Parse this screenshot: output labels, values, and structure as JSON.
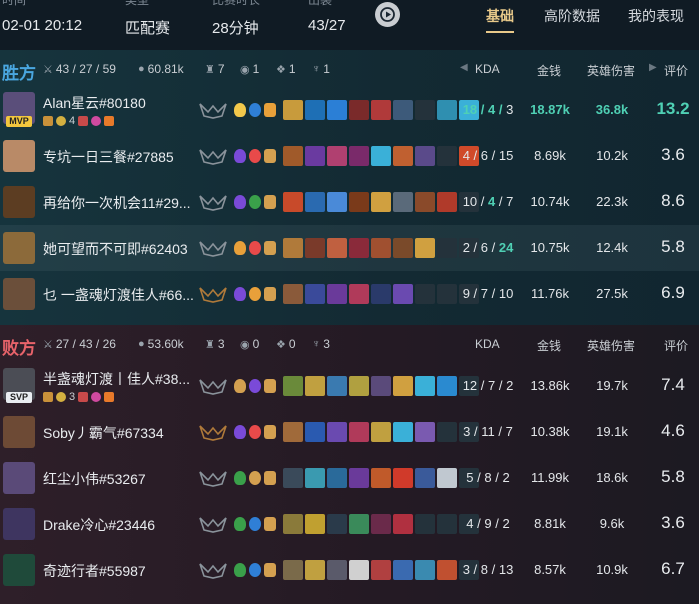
{
  "header": {
    "cols": [
      {
        "label": "时间",
        "value": "02-01 20:12"
      },
      {
        "label": "类型",
        "value": "匹配赛"
      },
      {
        "label": "比赛时长",
        "value": "28分钟"
      },
      {
        "label": "出装",
        "value": "43/27"
      }
    ],
    "tabs": [
      "基础",
      "高阶数据",
      "我的表现"
    ],
    "active_tab": "基础"
  },
  "columns": {
    "kda": "KDA",
    "gold": "金钱",
    "damage": "英雄伤害",
    "score": "评价"
  },
  "teams": [
    {
      "title": "胜方",
      "stats": {
        "kda": "43 / 27 / 59",
        "gold": "60.81k",
        "towers": "7",
        "dragons": "1",
        "heralds": "1",
        "barons": "1"
      },
      "players": [
        {
          "name": "Alan星云#80180",
          "badge": "MVP",
          "level_text": "4",
          "kda_k": "18",
          "kda_d": "4",
          "kda_a": "3",
          "gold": "18.87k",
          "damage": "36.8k",
          "score": "13.2",
          "colors": {
            "avatar": "#5a4e7a"
          }
        },
        {
          "name": "专坑一日三餐#27885",
          "kda_k": "4",
          "kda_d": "6",
          "kda_a": "15",
          "gold": "8.69k",
          "damage": "10.2k",
          "score": "3.6",
          "colors": {
            "avatar": "#b98a67"
          }
        },
        {
          "name": "再给你一次机会11#29...",
          "kda_k": "10",
          "kda_d": "4",
          "kda_a": "7",
          "gold": "10.74k",
          "damage": "22.3k",
          "score": "8.6",
          "colors": {
            "avatar": "#5c3d22"
          }
        },
        {
          "name": "她可望而不可即#62403",
          "kda_k": "2",
          "kda_d": "6",
          "kda_a": "24",
          "gold": "10.75k",
          "damage": "12.4k",
          "score": "5.8",
          "colors": {
            "avatar": "#8c6a3a"
          }
        },
        {
          "name": "乜 一盏魂灯渡佳人#66...",
          "kda_k": "9",
          "kda_d": "7",
          "kda_a": "10",
          "gold": "11.76k",
          "damage": "27.5k",
          "score": "6.9",
          "colors": {
            "avatar": "#6b4f3a"
          }
        }
      ]
    },
    {
      "title": "败方",
      "stats": {
        "kda": "27 / 43 / 26",
        "gold": "53.60k",
        "towers": "3",
        "dragons": "0",
        "heralds": "0",
        "barons": "3"
      },
      "players": [
        {
          "name": "半盏魂灯渡丨佳人#38...",
          "badge": "SVP",
          "level_text": "3",
          "kda_k": "12",
          "kda_d": "7",
          "kda_a": "2",
          "gold": "13.86k",
          "damage": "19.7k",
          "score": "7.4",
          "colors": {
            "avatar": "#4b4d55"
          }
        },
        {
          "name": "Soby丿霸气#67334",
          "kda_k": "3",
          "kda_d": "11",
          "kda_a": "7",
          "gold": "10.38k",
          "damage": "19.1k",
          "score": "4.6",
          "colors": {
            "avatar": "#6d4a35"
          }
        },
        {
          "name": "红尘小伟#53267",
          "kda_k": "5",
          "kda_d": "8",
          "kda_a": "2",
          "gold": "11.99k",
          "damage": "18.6k",
          "score": "5.8",
          "colors": {
            "avatar": "#5a4a78"
          }
        },
        {
          "name": "Drake冷心#23446",
          "kda_k": "4",
          "kda_d": "9",
          "kda_a": "2",
          "gold": "8.81k",
          "damage": "9.6k",
          "score": "3.6",
          "colors": {
            "avatar": "#3e3560"
          }
        },
        {
          "name": "奇迹行者#55987",
          "kda_k": "3",
          "kda_d": "8",
          "kda_a": "13",
          "gold": "8.57k",
          "damage": "10.9k",
          "score": "6.7",
          "colors": {
            "avatar": "#1f4a3a"
          }
        }
      ]
    }
  ]
}
